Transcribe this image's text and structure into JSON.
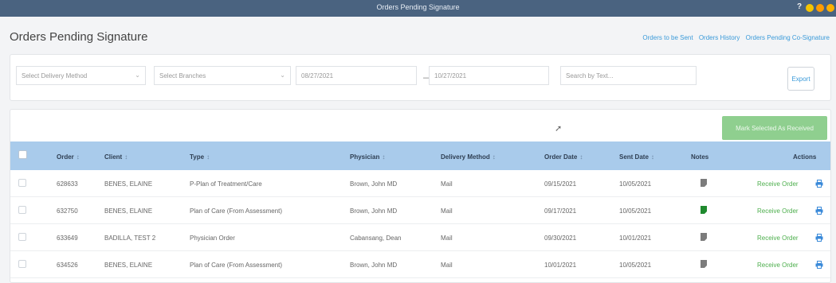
{
  "window": {
    "title": "Orders Pending Signature",
    "help_label": "?"
  },
  "window_dots": [
    {
      "color": "#f5c400"
    },
    {
      "color": "#ff9c00"
    },
    {
      "color": "#ffb000"
    }
  ],
  "page": {
    "title": "Orders Pending Signature"
  },
  "top_links": [
    "Orders to be Sent",
    "Orders History",
    "Orders Pending Co-Signature"
  ],
  "filters": {
    "delivery_method_placeholder": "Select Delivery Method",
    "branches_placeholder": "Select Branches",
    "date_from": "08/27/2021",
    "date_to": "10/27/2021",
    "search_placeholder": "Search by Text...",
    "export_label": "Export"
  },
  "table": {
    "mark_button_label": "Mark Selected As Received",
    "columns": [
      "Order",
      "Client",
      "Type",
      "Physician",
      "Delivery Method",
      "Order Date",
      "Sent Date",
      "Notes",
      "Actions"
    ],
    "rows": [
      {
        "order": "628633",
        "client": "BENES, ELAINE",
        "type": "P-Plan of Treatment/Care",
        "physician": "Brown, John MD",
        "delivery": "Mail",
        "order_date": "09/15/2021",
        "sent_date": "10/05/2021",
        "note_color": "#7c7c7c",
        "action": "Receive Order"
      },
      {
        "order": "632750",
        "client": "BENES, ELAINE",
        "type": "Plan of Care (From Assessment)",
        "physician": "Brown, John MD",
        "delivery": "Mail",
        "order_date": "09/17/2021",
        "sent_date": "10/05/2021",
        "note_color": "#1f8a2e",
        "action": "Receive Order"
      },
      {
        "order": "633649",
        "client": "BADILLA, TEST 2",
        "type": "Physician Order",
        "physician": "Cabansang, Dean",
        "delivery": "Mail",
        "order_date": "09/30/2021",
        "sent_date": "10/01/2021",
        "note_color": "#7c7c7c",
        "action": "Receive Order"
      },
      {
        "order": "634526",
        "client": "BENES, ELAINE",
        "type": "Plan of Care (From Assessment)",
        "physician": "Brown, John MD",
        "delivery": "Mail",
        "order_date": "10/01/2021",
        "sent_date": "10/05/2021",
        "note_color": "#7c7c7c",
        "action": "Receive Order"
      }
    ]
  },
  "icons": {
    "note": "note-icon",
    "print": "print-icon",
    "sort": "sort-icon",
    "cursor": "mouse-cursor-icon"
  }
}
